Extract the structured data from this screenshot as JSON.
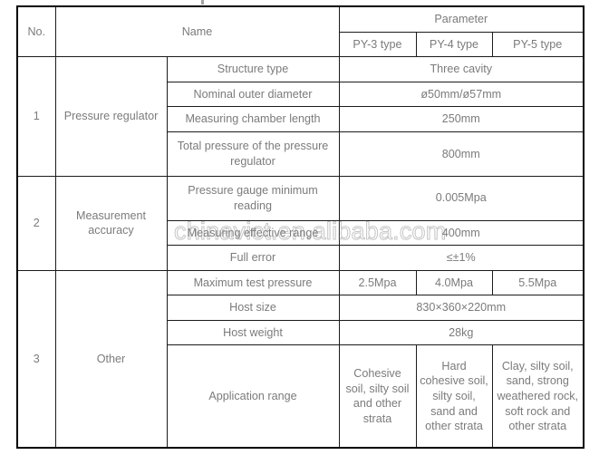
{
  "watermark": {
    "text": "chinavict.en.alibaba.com"
  },
  "table": {
    "header": {
      "no": "No.",
      "name": "Name",
      "parameter": "Parameter",
      "types": [
        "PY-3 type",
        "PY-4 type",
        "PY-5 type"
      ]
    },
    "sections": [
      {
        "no": "1",
        "category": "Pressure regulator",
        "rows": [
          {
            "label": "Structure type",
            "span": "all",
            "values": [
              "Three cavity"
            ]
          },
          {
            "label": "Nominal outer diameter",
            "span": "all",
            "values": [
              "ø50mm/ø57mm"
            ]
          },
          {
            "label": "Measuring chamber length",
            "span": "all",
            "values": [
              "250mm"
            ]
          },
          {
            "label": "Total pressure of the pressure regulator",
            "span": "all",
            "values": [
              "800mm"
            ]
          }
        ]
      },
      {
        "no": "2",
        "category": "Measurement accuracy",
        "rows": [
          {
            "label": "Pressure gauge minimum reading",
            "span": "all",
            "values": [
              "0.005Mpa"
            ]
          },
          {
            "label": "Measuring effective range",
            "span": "all",
            "values": [
              "400mm"
            ]
          },
          {
            "label": "Full error",
            "span": "all",
            "values": [
              "≤±1%"
            ]
          }
        ]
      },
      {
        "no": "3",
        "category": "Other",
        "rows": [
          {
            "label": "Maximum test pressure",
            "span": "each",
            "values": [
              "2.5Mpa",
              "4.0Mpa",
              "5.5Mpa"
            ]
          },
          {
            "label": "Host size",
            "span": "all",
            "values": [
              "830×360×220mm"
            ]
          },
          {
            "label": "Host weight",
            "span": "all",
            "values": [
              "28kg"
            ]
          },
          {
            "label": "Application range",
            "span": "each",
            "values": [
              "Cohesive soil, silty soil and other strata",
              "Hard cohesive soil, silty soil, sand and other strata",
              "Clay, silty soil, sand, strong weathered rock, soft rock and other strata"
            ]
          }
        ]
      }
    ]
  }
}
